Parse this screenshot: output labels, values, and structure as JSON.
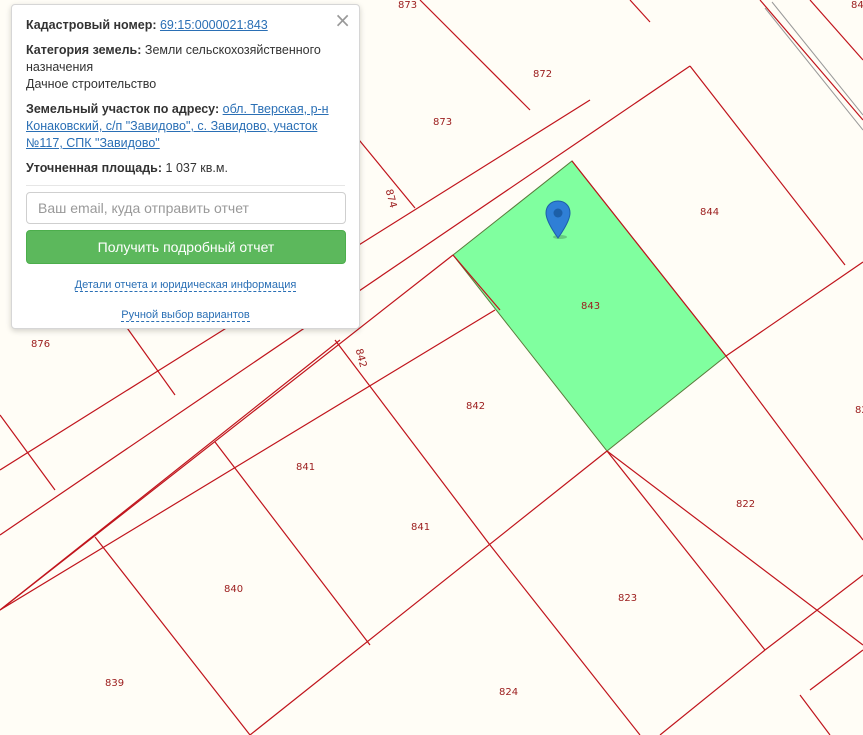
{
  "map": {
    "highlight_color": "#80ff9f",
    "boundary_color": "#c0141c",
    "plots": {
      "p843": "843",
      "p844": "844",
      "p842a": "842",
      "p842b": "842",
      "p841a": "841",
      "p841b": "841",
      "p840": "840",
      "p839": "839",
      "p822": "822",
      "p823": "823",
      "p824": "824",
      "p872": "872",
      "p873a": "873",
      "p873b": "873",
      "p874": "874",
      "p876": "876",
      "p84x": "84",
      "p82x": "82"
    }
  },
  "popup": {
    "cadastral_label": "Кадастровый номер:",
    "cadastral_value": "69:15:0000021:843",
    "category_label": "Категория земель:",
    "category_value": "Земли сельскохозяйственного назначения",
    "category_use": "Дачное строительство",
    "address_label": "Земельный участок по адресу:",
    "address_value": "обл. Тверская, р-н Конаковский, с/п \"Завидово\", с. Завидово, участок №117, СПК \"Завидово\"",
    "area_label": "Уточненная площадь:",
    "area_value": "1 037 кв.м.",
    "email_placeholder": "Ваш email, куда отправить отчет",
    "button_label": "Получить подробный отчет",
    "details_link": "Детали отчета и юридическая информация",
    "manual_link": "Ручной выбор вариантов",
    "close_icon": "×"
  }
}
